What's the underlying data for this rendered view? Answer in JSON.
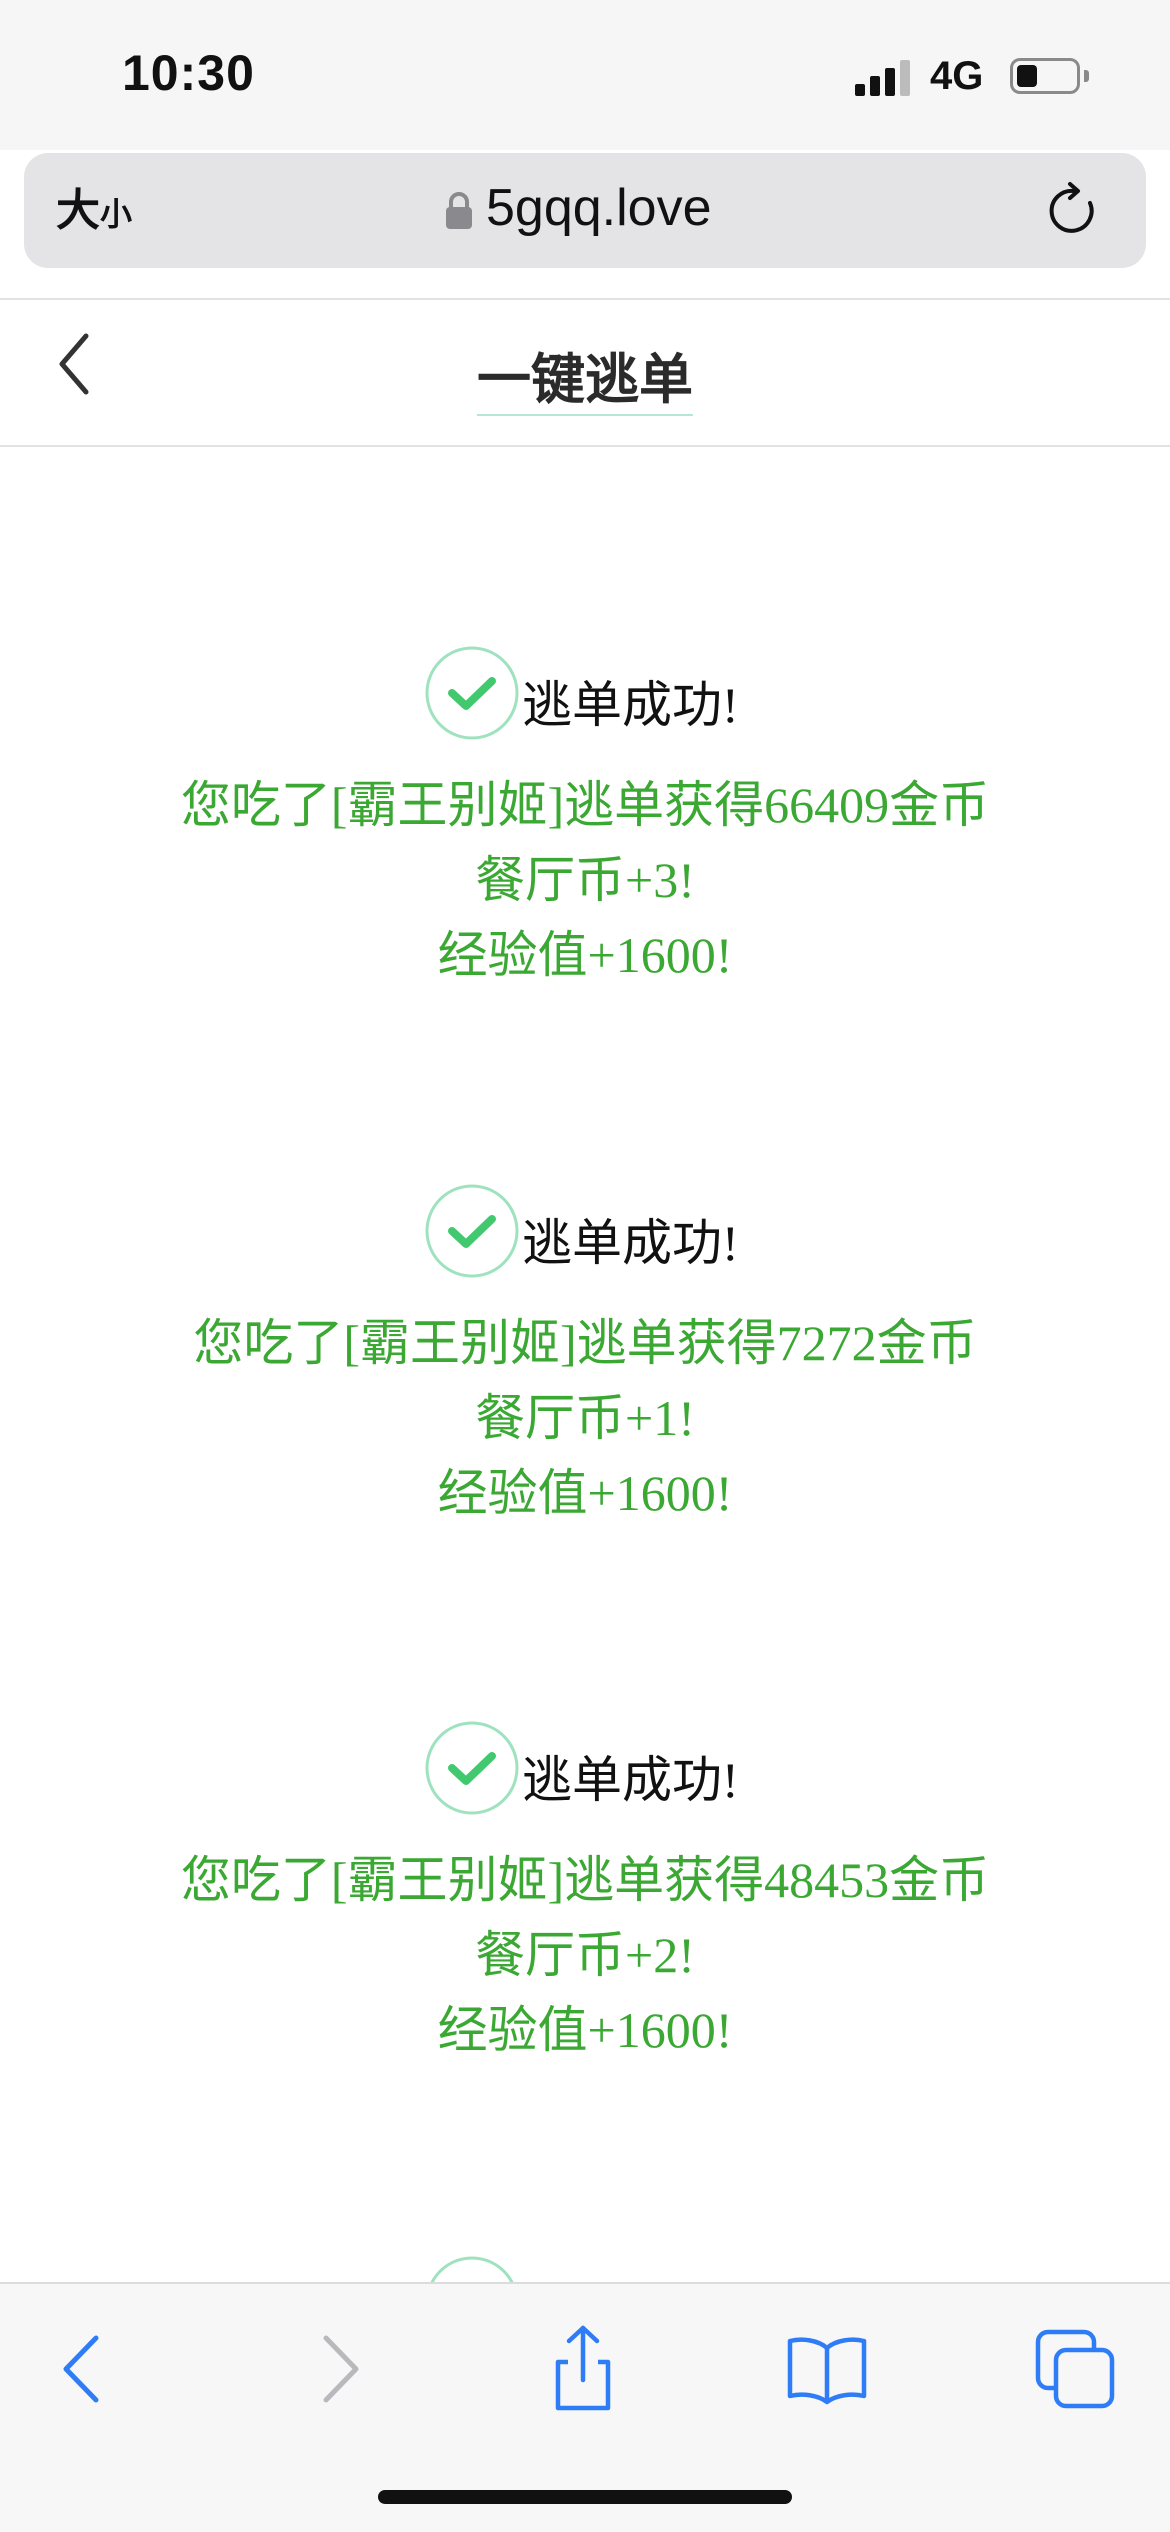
{
  "status_bar": {
    "time": "10:30",
    "network": "4G",
    "battery_level": 0.35
  },
  "browser": {
    "text_size_big": "大",
    "text_size_small": "小",
    "url": "5gqq.love"
  },
  "header": {
    "title": "一键逃单"
  },
  "results": [
    {
      "status": "逃单成功!",
      "line1": "您吃了[霸王别姬]逃单获得66409金币",
      "line2": "餐厅币+3!",
      "line3": "经验值+1600!"
    },
    {
      "status": "逃单成功!",
      "line1": "您吃了[霸王别姬]逃单获得7272金币",
      "line2": "餐厅币+1!",
      "line3": "经验值+1600!"
    },
    {
      "status": "逃单成功!",
      "line1": "您吃了[霸王别姬]逃单获得48453金币",
      "line2": "餐厅币+2!",
      "line3": "经验值+1600!"
    }
  ],
  "colors": {
    "success_green": "#3aa832",
    "check_green": "#42c96f",
    "ios_blue": "#2f7df6"
  },
  "icons": {
    "toolbar": [
      "back-icon",
      "forward-icon",
      "share-icon",
      "bookmarks-icon",
      "tabs-icon"
    ]
  }
}
